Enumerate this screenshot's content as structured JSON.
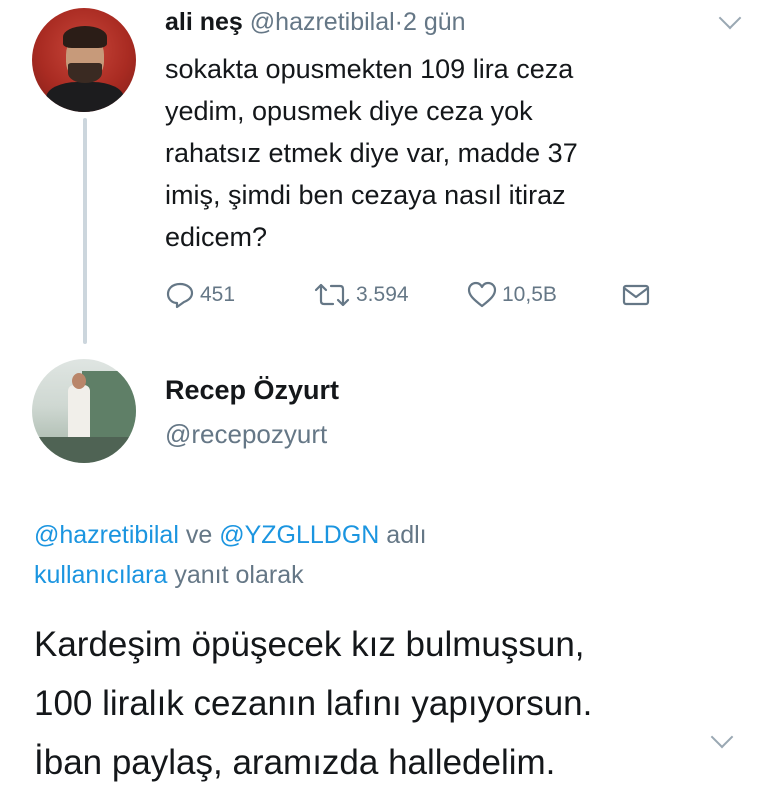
{
  "tweet": {
    "author_name": "ali neş",
    "handle": "@hazretibilal",
    "separator": "·",
    "time": "2 gün",
    "lines": [
      "sokakta opusmekten 109 lira ceza",
      "yedim, opusmek diye ceza yok",
      "rahatsız etmek diye var, madde 37",
      "imiş, şimdi ben cezaya nasıl itiraz",
      "edicem?"
    ],
    "actions": {
      "replies": "451",
      "retweets": "3.594",
      "likes": "10,5B"
    }
  },
  "reply": {
    "author_name": "Recep Özyurt",
    "handle": "@recepozyurt",
    "replying_to": {
      "mention1": "@hazretibilal",
      "conj": "ve",
      "mention2": "@YZGLLDGN",
      "suffix1": "adlı",
      "word2": "kullanıcılara",
      "suffix2": "yanıt olarak"
    },
    "lines": [
      "Kardeşim öpüşecek kız bulmuşsun,",
      "100 liralık cezanın lafını yapıyorsun.",
      "İban paylaş, aramızda halledelim."
    ]
  },
  "icons": [
    "chevron-down-icon",
    "reply-icon",
    "retweet-icon",
    "heart-icon",
    "mail-icon"
  ],
  "colors": {
    "text": "#14171a",
    "muted": "#657786",
    "link": "#1b95e0",
    "thread_line": "#ccd6dd"
  }
}
